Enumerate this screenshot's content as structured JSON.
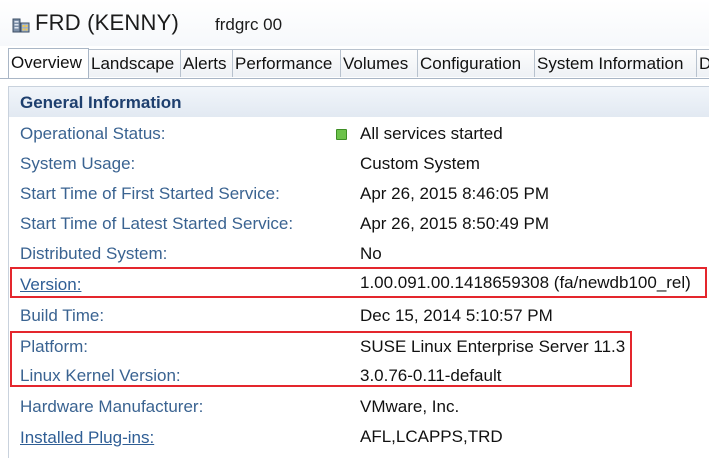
{
  "header": {
    "title": "FRD (KENNY)",
    "subtitle": "frdgrc 00",
    "icon": "system-icon"
  },
  "tabs": [
    {
      "label": "Overview",
      "active": true
    },
    {
      "label": "Landscape",
      "active": false
    },
    {
      "label": "Alerts",
      "active": false
    },
    {
      "label": "Performance",
      "active": false
    },
    {
      "label": "Volumes",
      "active": false
    },
    {
      "label": "Configuration",
      "active": false
    },
    {
      "label": "System Information",
      "active": false
    },
    {
      "label": "D",
      "active": false
    }
  ],
  "section": {
    "title": "General Information"
  },
  "rows": [
    {
      "label": "Operational Status:",
      "value": "All services started",
      "status_color": "#6cc24a"
    },
    {
      "label": "System Usage:",
      "value": "Custom System"
    },
    {
      "label": "Start Time of First Started Service:",
      "value": "Apr 26, 2015 8:46:05 PM"
    },
    {
      "label": "Start Time of Latest Started Service:",
      "value": "Apr 26, 2015 8:50:49 PM"
    },
    {
      "label": "Distributed System:",
      "value": "No"
    },
    {
      "label": "Version:",
      "value": "1.00.091.00.1418659308 (fa/newdb100_rel)",
      "link": true
    },
    {
      "label": "Build Time:",
      "value": "Dec 15, 2014 5:10:57 PM"
    },
    {
      "label": "Platform:",
      "value": "SUSE Linux Enterprise Server 11.3"
    },
    {
      "label": "Linux Kernel Version:",
      "value": "3.0.76-0.11-default"
    },
    {
      "label": "Hardware Manufacturer:",
      "value": "VMware, Inc."
    },
    {
      "label": "Installed Plug-ins:",
      "value": "AFL,LCAPPS,TRD",
      "link": true
    }
  ],
  "colors": {
    "highlight": "#e4262d",
    "label": "#3a6391",
    "section_title": "#1e3f6e"
  }
}
